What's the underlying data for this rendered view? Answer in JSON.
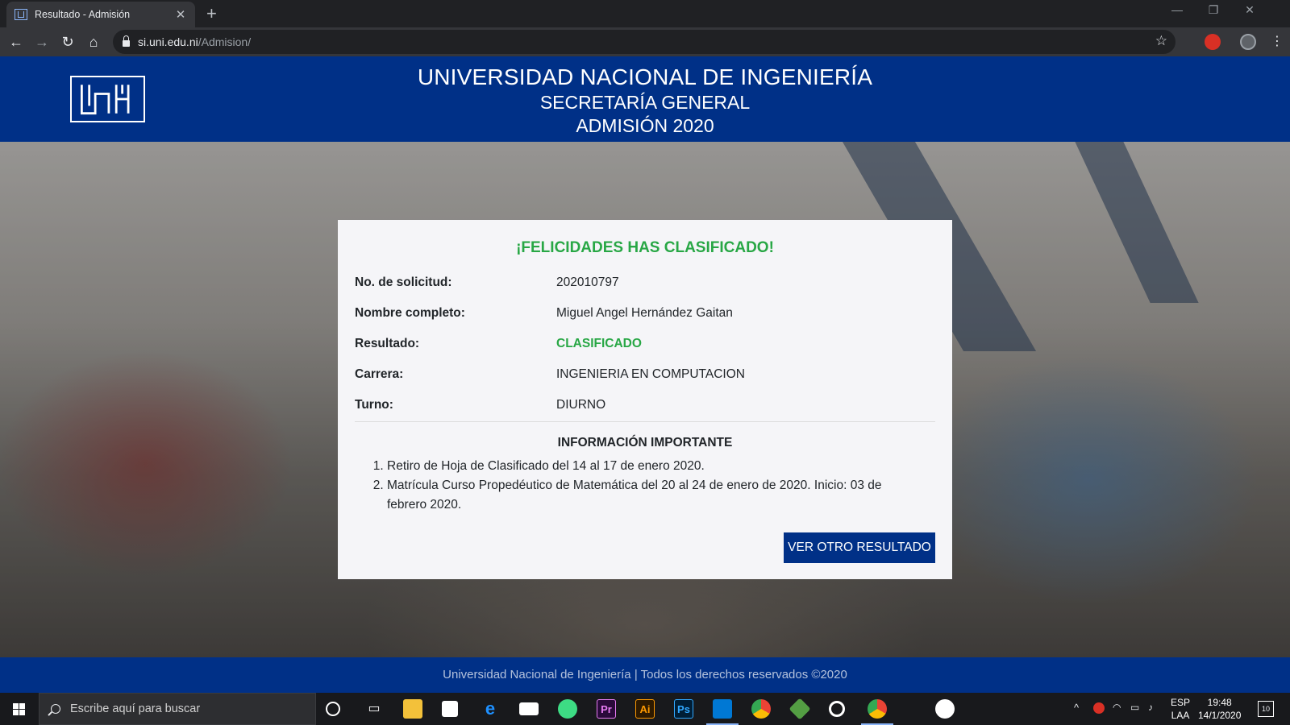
{
  "browser": {
    "tab_title": "Resultado - Admisión",
    "tab_close": "✕",
    "new_tab": "+",
    "url_host": "si.uni.edu.ni",
    "url_path": "/Admision/",
    "window_controls": [
      "—",
      "❐",
      "✕"
    ]
  },
  "header": {
    "line1": "UNIVERSIDAD NACIONAL DE INGENIERÍA",
    "line2": "SECRETARÍA GENERAL",
    "line3": "ADMISIÓN 2020"
  },
  "card": {
    "title": "¡FELICIDADES HAS CLASIFICADO!",
    "rows": [
      {
        "label": "No. de solicitud:",
        "value": "202010797"
      },
      {
        "label": "Nombre completo:",
        "value": "Miguel Angel Hernández Gaitan"
      },
      {
        "label": "Resultado:",
        "value": "CLASIFICADO"
      },
      {
        "label": "Carrera:",
        "value": "INGENIERIA EN COMPUTACION"
      },
      {
        "label": "Turno:",
        "value": "DIURNO"
      }
    ],
    "important_title": "INFORMACIÓN IMPORTANTE",
    "important_items": [
      "Retiro de Hoja de Clasificado del 14 al 17 de enero 2020.",
      "Matrícula Curso Propedéutico de Matemática del 20 al 24 de enero de 2020. Inicio: 03 de febrero 2020."
    ],
    "button_label": "VER OTRO RESULTADO"
  },
  "footer": {
    "text": "Universidad Nacional de Ingeniería | Todos los derechos reservados ©2020"
  },
  "taskbar": {
    "search_placeholder": "Escribe aquí para buscar",
    "lang_line1": "ESP",
    "lang_line2": "LAA",
    "time": "19:48",
    "date": "14/1/2020",
    "notifications": "10",
    "pinned_apps": [
      "cortana-icon",
      "task-view-icon",
      "file-explorer-icon",
      "store-icon",
      "edge-icon",
      "mail-icon",
      "android-studio-icon",
      "premiere-icon",
      "illustrator-icon",
      "photoshop-icon",
      "vscode-icon",
      "chrome-icon",
      "nodejs-icon",
      "obs-icon",
      "chrome-profile-icon",
      "app-green-icon"
    ],
    "app_labels": {
      "premiere": "Pr",
      "illustrator": "Ai",
      "photoshop": "Ps"
    }
  },
  "colors": {
    "brand_blue": "#003087",
    "success_green": "#28a745"
  }
}
